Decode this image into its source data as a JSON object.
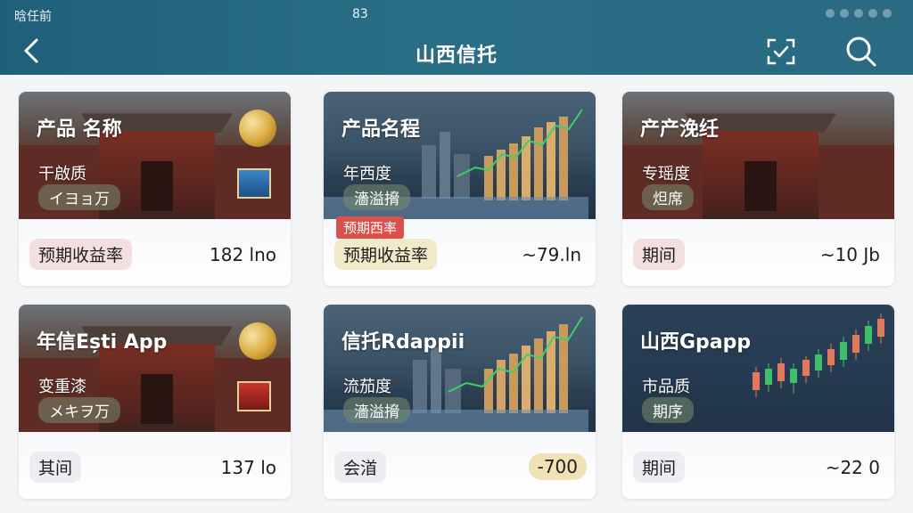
{
  "status_bar": {
    "left": "晗任前",
    "center": "83"
  },
  "header": {
    "title": "山西信托"
  },
  "colors": {
    "header_start": "#1f5f7a",
    "header_end": "#2a6a83",
    "badge_red": "#d8514b"
  },
  "icons": {
    "back": "chevron-left-icon",
    "scan": "scan-icon",
    "search": "search-icon"
  },
  "cards": [
    {
      "title": "产品 名称",
      "sub": "干啟质",
      "pill": "イヨョ万",
      "footer_label": "预期收益率",
      "footer_value": "182 lno",
      "image": "temple"
    },
    {
      "title": "产品名程",
      "sub": "年西度",
      "pill": "濇溢搚",
      "badge": "预期西率",
      "footer_label": "预期收益率",
      "footer_value": "~79.ln",
      "image": "city"
    },
    {
      "title": "产产浼纴",
      "sub": "专瑶度",
      "pill": "炟席",
      "footer_label": "期间",
      "footer_value": "~10 Jb",
      "image": "temple"
    },
    {
      "title": "年信Ești App",
      "sub": "变重漆",
      "pill": "メキヲ万",
      "footer_label": "其间",
      "footer_value": "137 lo",
      "image": "temple"
    },
    {
      "title": "信托Rdappii",
      "sub": "流茄度",
      "pill": "濇溢搚",
      "footer_label": "会渞",
      "footer_value": "-700",
      "image": "city"
    },
    {
      "title": "山西Gpapp",
      "sub": "市品质",
      "pill": "期序",
      "footer_label": "期间",
      "footer_value": "~22 0",
      "image": "candle"
    }
  ]
}
